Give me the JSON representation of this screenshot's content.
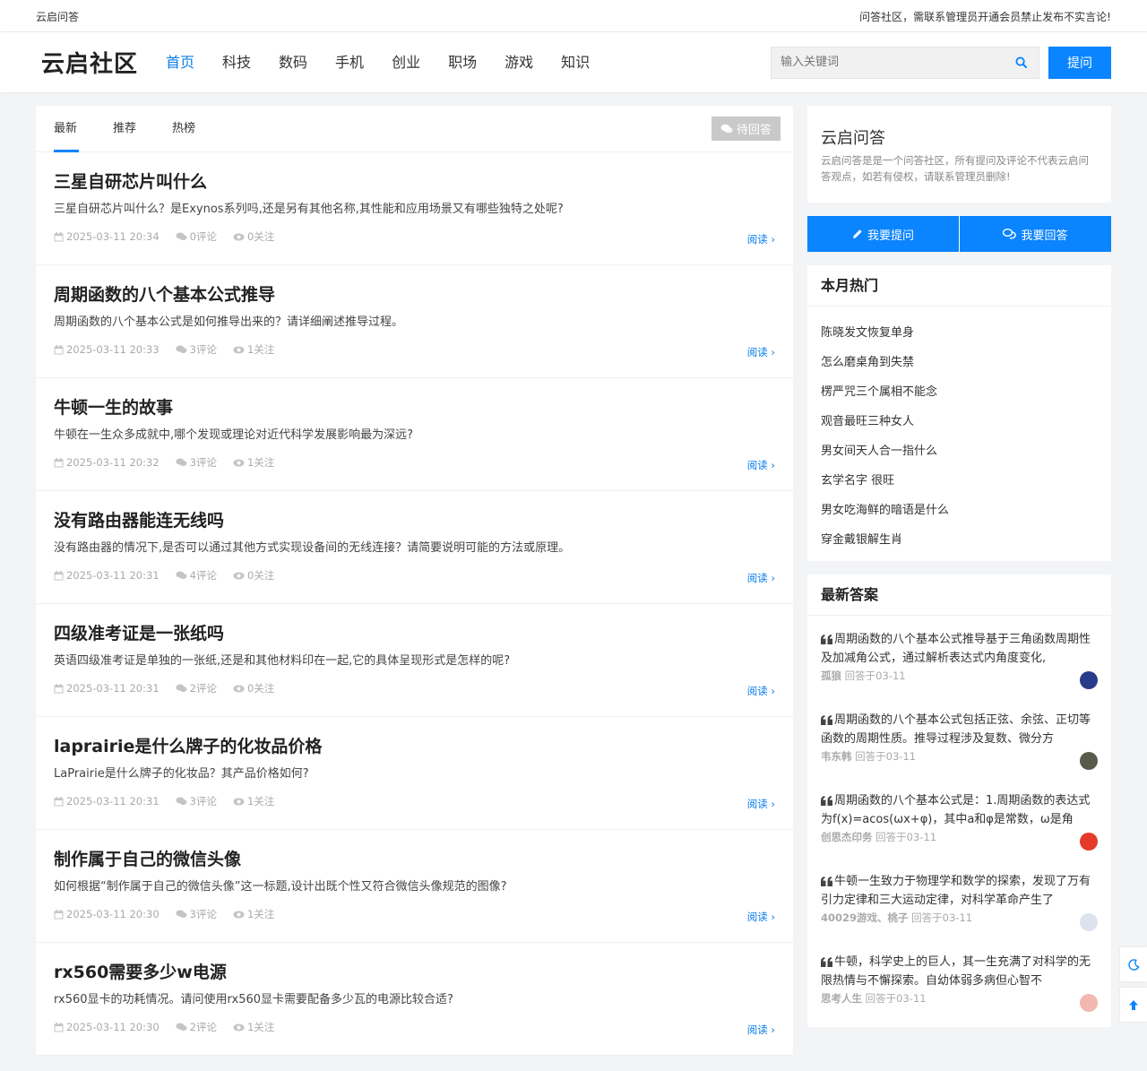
{
  "topbar": {
    "left": "云启问答",
    "right": "问答社区，需联系管理员开通会员禁止发布不实言论!"
  },
  "header": {
    "logo": "云启社区",
    "nav": [
      "首页",
      "科技",
      "数码",
      "手机",
      "创业",
      "职场",
      "游戏",
      "知识"
    ],
    "search_placeholder": "输入关键词",
    "ask_label": "提问"
  },
  "feed": {
    "tabs": [
      "最新",
      "推荐",
      "热榜"
    ],
    "pending_label": "待回答",
    "read_label": "阅读",
    "items": [
      {
        "title": "三星自研芯片叫什么",
        "desc": "三星自研芯片叫什么？是Exynos系列吗,还是另有其他名称,其性能和应用场景又有哪些独特之处呢?",
        "date": "2025-03-11 20:34",
        "comments": "0评论",
        "follows": "0关注"
      },
      {
        "title": "周期函数的八个基本公式推导",
        "desc": "周期函数的八个基本公式是如何推导出来的？请详细阐述推导过程。",
        "date": "2025-03-11 20:33",
        "comments": "3评论",
        "follows": "1关注"
      },
      {
        "title": "牛顿一生的故事",
        "desc": "牛顿在一生众多成就中,哪个发现或理论对近代科学发展影响最为深远?",
        "date": "2025-03-11 20:32",
        "comments": "3评论",
        "follows": "1关注"
      },
      {
        "title": "没有路由器能连无线吗",
        "desc": "没有路由器的情况下,是否可以通过其他方式实现设备间的无线连接？请简要说明可能的方法或原理。",
        "date": "2025-03-11 20:31",
        "comments": "4评论",
        "follows": "0关注"
      },
      {
        "title": "四级准考证是一张纸吗",
        "desc": "英语四级准考证是单独的一张纸,还是和其他材料印在一起,它的具体呈现形式是怎样的呢?",
        "date": "2025-03-11 20:31",
        "comments": "2评论",
        "follows": "0关注"
      },
      {
        "title": "laprairie是什么牌子的化妆品价格",
        "desc": "LaPrairie是什么牌子的化妆品？其产品价格如何?",
        "date": "2025-03-11 20:31",
        "comments": "3评论",
        "follows": "1关注"
      },
      {
        "title": "制作属于自己的微信头像",
        "desc": "如何根据“制作属于自己的微信头像”这一标题,设计出既个性又符合微信头像规范的图像?",
        "date": "2025-03-11 20:30",
        "comments": "3评论",
        "follows": "1关注"
      },
      {
        "title": "rx560需要多少w电源",
        "desc": "rx560显卡的功耗情况。请问使用rx560显卡需要配备多少瓦的电源比较合适?",
        "date": "2025-03-11 20:30",
        "comments": "2评论",
        "follows": "1关注"
      }
    ]
  },
  "sidebar": {
    "about_title": "云启问答",
    "about_text": "云启问答是是一个问答社区，所有提问及评论不代表云启问答观点，如若有侵权，请联系管理员删除!",
    "ask_button": "我要提问",
    "answer_button": "我要回答",
    "hot_title": "本月热门",
    "hot_items": [
      "陈晓发文恢复单身",
      "怎么磨桌角到失禁",
      "楞严咒三个属相不能念",
      "观音最旺三种女人",
      "男女间天人合一指什么",
      "玄学名字 很旺",
      "男女吃海鲜的暗语是什么",
      "穿金戴银解生肖"
    ],
    "answers_title": "最新答案",
    "answers": [
      {
        "text": "周期函数的八个基本公式推导基于三角函数周期性及加减角公式，通过解析表达式内角度变化,",
        "user": "孤狼",
        "time": "回答于03-11",
        "avatar_color": "#2a3a8a"
      },
      {
        "text": "周期函数的八个基本公式包括正弦、余弦、正切等函数的周期性质。推导过程涉及复数、微分方",
        "user": "韦东韩",
        "time": "回答于03-11",
        "avatar_color": "#5a5a4a"
      },
      {
        "text": "周期函数的八个基本公式是：1.周期函数的表达式为f(x)=acos(ωx+φ)，其中a和φ是常数，ω是角",
        "user": "创思杰印务",
        "time": "回答于03-11",
        "avatar_color": "#e53a2a"
      },
      {
        "text": "牛顿一生致力于物理学和数学的探索，发现了万有引力定律和三大运动定律，对科学革命产生了",
        "user": "40029游戏、桃子",
        "time": "回答于03-11",
        "avatar_color": "#dde3ee"
      },
      {
        "text": "牛顿，科学史上的巨人，其一生充满了对科学的无限热情与不懈探索。自幼体弱多病但心智不",
        "user": "思考人生",
        "time": "回答于03-11",
        "avatar_color": "#f2b8b0"
      }
    ]
  },
  "colors": {
    "accent": "#0a84ff",
    "link": "#0a7eea",
    "pending": "#c9c9c9"
  }
}
